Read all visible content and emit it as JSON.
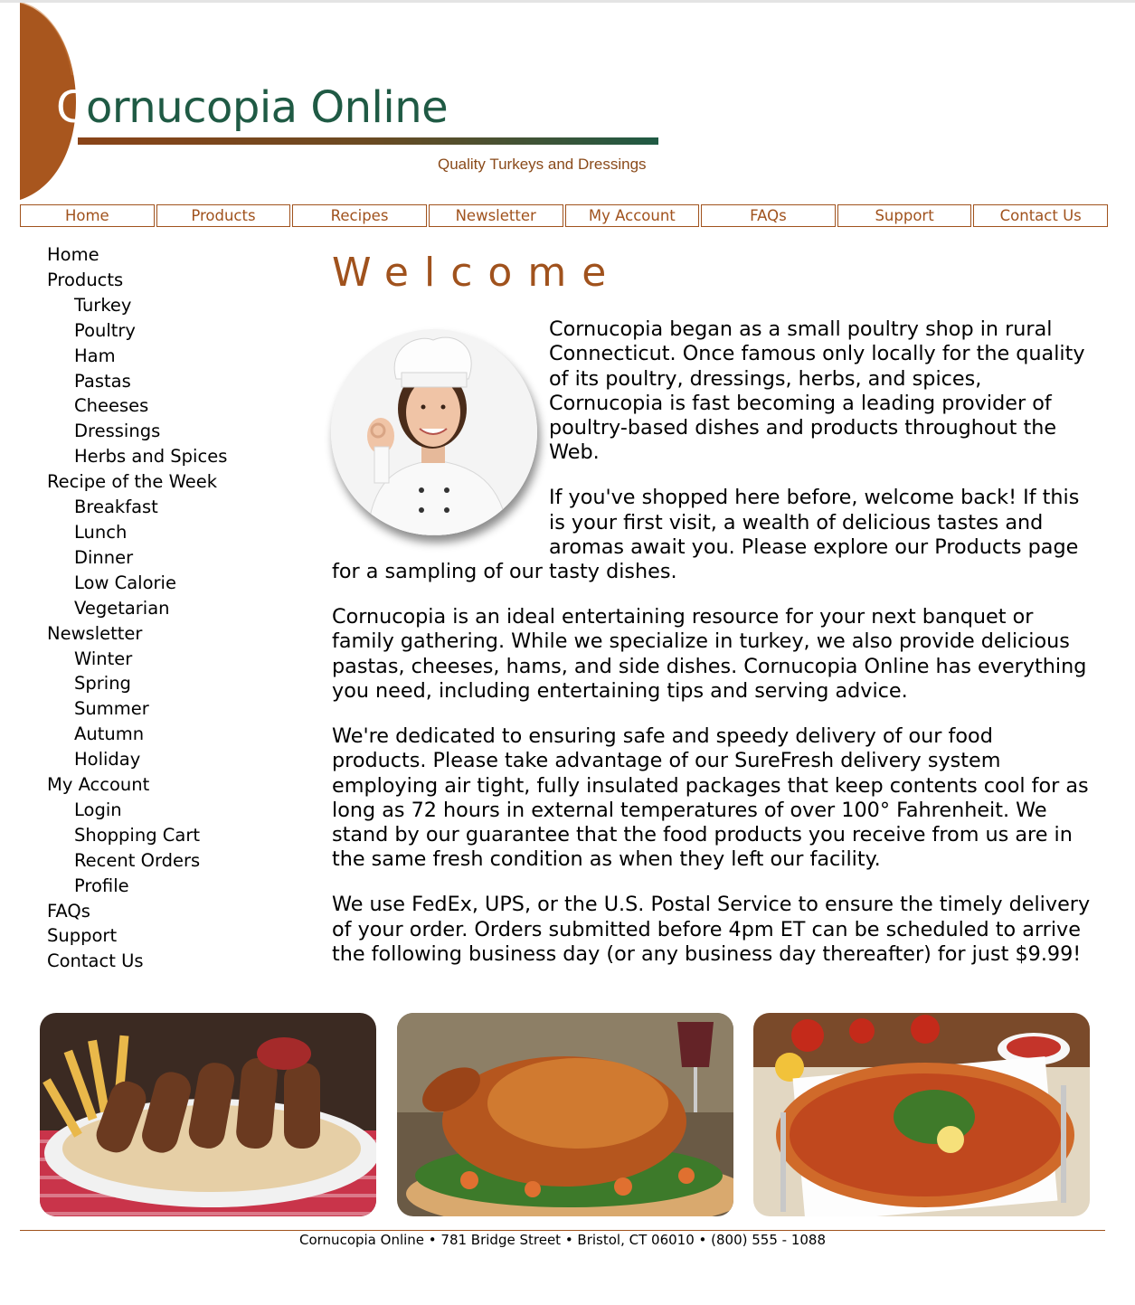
{
  "header": {
    "logo_c": "C",
    "logo_rest": "ornucopia Online",
    "tagline": "Quality Turkeys and Dressings",
    "accent_color": "#a0521d",
    "logo_green": "#1f5a44"
  },
  "topnav": [
    "Home",
    "Products",
    "Recipes",
    "Newsletter",
    "My Account",
    "FAQs",
    "Support",
    "Contact Us"
  ],
  "sidenav": [
    {
      "label": "Home",
      "level": 0
    },
    {
      "label": "Products",
      "level": 0
    },
    {
      "label": "Turkey",
      "level": 1
    },
    {
      "label": "Poultry",
      "level": 1
    },
    {
      "label": "Ham",
      "level": 1
    },
    {
      "label": "Pastas",
      "level": 1
    },
    {
      "label": "Cheeses",
      "level": 1
    },
    {
      "label": "Dressings",
      "level": 1
    },
    {
      "label": "Herbs and Spices",
      "level": 1
    },
    {
      "label": "Recipe of the Week",
      "level": 0
    },
    {
      "label": "Breakfast",
      "level": 1
    },
    {
      "label": "Lunch",
      "level": 1
    },
    {
      "label": "Dinner",
      "level": 1
    },
    {
      "label": "Low Calorie",
      "level": 1
    },
    {
      "label": "Vegetarian",
      "level": 1
    },
    {
      "label": "Newsletter",
      "level": 0
    },
    {
      "label": "Winter",
      "level": 1
    },
    {
      "label": "Spring",
      "level": 1
    },
    {
      "label": "Summer",
      "level": 1
    },
    {
      "label": "Autumn",
      "level": 1
    },
    {
      "label": "Holiday",
      "level": 1
    },
    {
      "label": "My Account",
      "level": 0
    },
    {
      "label": "Login",
      "level": 1
    },
    {
      "label": "Shopping Cart",
      "level": 1
    },
    {
      "label": "Recent Orders",
      "level": 1
    },
    {
      "label": "Profile",
      "level": 1
    },
    {
      "label": "FAQs",
      "level": 0
    },
    {
      "label": "Support",
      "level": 0
    },
    {
      "label": "Contact Us",
      "level": 0
    }
  ],
  "main": {
    "title": "Welcome",
    "paragraphs": [
      "Cornucopia began as a small poultry shop in rural Connecticut. Once famous only locally for the quality of its poultry, dressings, herbs, and spices, Cornucopia is fast becoming a leading provider of poultry-based dishes and products throughout the Web.",
      "If you've shopped here before, welcome back! If this is your first visit, a wealth of delicious tastes and aromas await you. Please explore our Products page for a sampling of our tasty dishes.",
      "Cornucopia is an ideal entertaining resource for your next banquet or family gathering. While we specialize in turkey, we also provide delicious pastas, cheeses, hams, and side dishes. Cornucopia Online has everything you need, including entertaining tips and serving advice.",
      "We're dedicated to ensuring safe and speedy delivery of our food products. Please take advantage of our SureFresh delivery system employing air tight, fully insulated packages that keep contents cool for as long as 72 hours in external temperatures of over 100° Fahrenheit. We stand by our guarantee that the food products you receive from us are in the same fresh condition as when they left our facility.",
      "We use FedEx, UPS, or the U.S. Postal Service to ensure the timely delivery of your order. Orders submitted before 4pm ET can be scheduled to arrive the following business day (or any business day thereafter) for just $9.99!"
    ]
  },
  "footer": {
    "address": "Cornucopia Online • 781 Bridge Street • Bristol, CT 06010 • (800) 555 - 1088"
  }
}
